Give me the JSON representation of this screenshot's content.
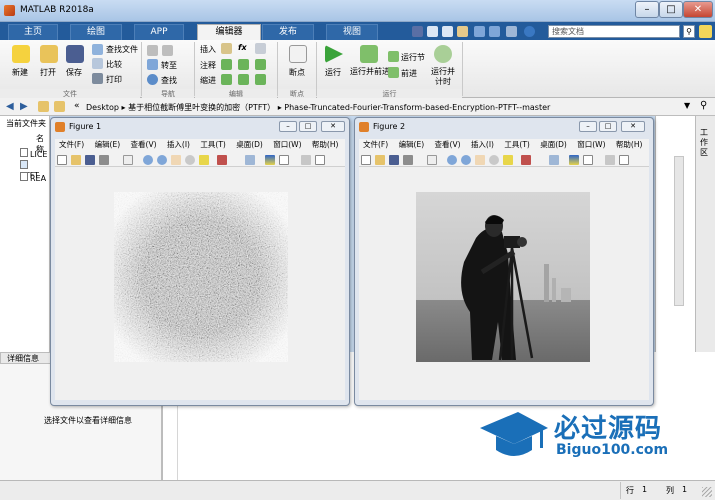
{
  "window": {
    "title": "MATLAB R2018a"
  },
  "tabs": [
    "主页",
    "绘图",
    "APP",
    "编辑器",
    "发布",
    "视图"
  ],
  "search": {
    "placeholder": "搜索文档"
  },
  "ribbon": {
    "file": {
      "new": "新建",
      "open": "打开",
      "save": "保存",
      "find_files": "查找文件",
      "compare": "比较",
      "print": "打印",
      "group": "文件"
    },
    "navigate": {
      "goto": "转至",
      "find": "查找",
      "group": "导航"
    },
    "edit": {
      "insert": "插入",
      "comment": "注释",
      "indent": "缩进",
      "fx": "fx",
      "group": "编辑"
    },
    "breakpoints": {
      "label": "断点",
      "group": "断点"
    },
    "run": {
      "run": "运行",
      "run_advance": "运行并前进",
      "run_section": "运行节",
      "advance": "前进",
      "run_time": "运行并计时",
      "group": "运行"
    }
  },
  "address": {
    "prefix": "«",
    "segments": [
      "Desktop",
      "基于相位截断傅里叶变换的加密（PTFT）",
      "Phase-Truncated-Fourier-Transform-based-Encryption-PTFT--master"
    ]
  },
  "left_pane": {
    "header": "当前文件夹",
    "col_name": "名称",
    "items": [
      "LICE",
      "PTFT",
      "REA"
    ]
  },
  "details": {
    "header": "详细信息",
    "empty_text": "选择文件以查看详细信息"
  },
  "status": {
    "row_label": "行",
    "row": "1",
    "col_label": "列",
    "col": "1"
  },
  "side_panel": {
    "label": "工作区"
  },
  "figures": [
    {
      "title": "Figure 1",
      "menu": [
        "文件(F)",
        "编辑(E)",
        "查看(V)",
        "插入(I)",
        "工具(T)",
        "桌面(D)",
        "窗口(W)",
        "帮助(H)"
      ]
    },
    {
      "title": "Figure 2",
      "menu": [
        "文件(F)",
        "编辑(E)",
        "查看(V)",
        "插入(I)",
        "工具(T)",
        "桌面(D)",
        "窗口(W)",
        "帮助(H)"
      ]
    }
  ],
  "watermark": {
    "brand": "必过源码",
    "url": "Biguo100.com"
  },
  "colors": {
    "tab_bar": "#235b9b",
    "accent": "#1a7fd4",
    "watermark": "#1a6fb8"
  }
}
